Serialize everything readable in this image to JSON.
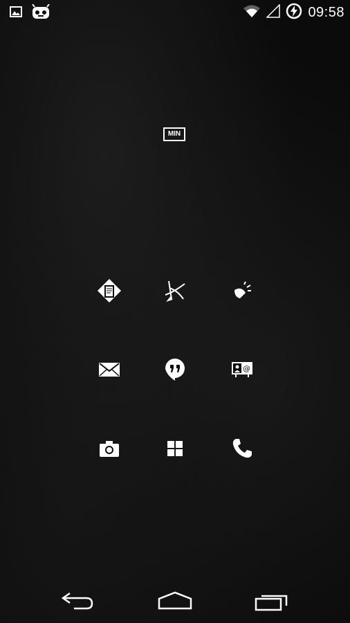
{
  "status_bar": {
    "time": "09:58",
    "icons": [
      "image-icon",
      "cyanogenmod-icon",
      "wifi-icon",
      "signal-icon",
      "battery-charging-icon"
    ]
  },
  "widget": {
    "label": "MIN"
  },
  "apps": [
    {
      "name": "reader-app",
      "icon": "book-diamond-icon"
    },
    {
      "name": "unknown-app",
      "icon": "crossed-arrow-icon"
    },
    {
      "name": "flashlight-app",
      "icon": "flashlight-icon"
    },
    {
      "name": "email-app",
      "icon": "envelope-icon"
    },
    {
      "name": "hangouts-app",
      "icon": "hangouts-icon"
    },
    {
      "name": "contacts-app",
      "icon": "contact-card-icon"
    },
    {
      "name": "camera-app",
      "icon": "camera-icon"
    },
    {
      "name": "app-drawer",
      "icon": "grid-icon"
    },
    {
      "name": "phone-app",
      "icon": "phone-icon"
    }
  ],
  "nav_bar": {
    "buttons": [
      "back-icon",
      "home-icon",
      "recents-icon"
    ]
  },
  "colors": {
    "background": "#0b0b0b",
    "foreground": "#ffffff"
  }
}
